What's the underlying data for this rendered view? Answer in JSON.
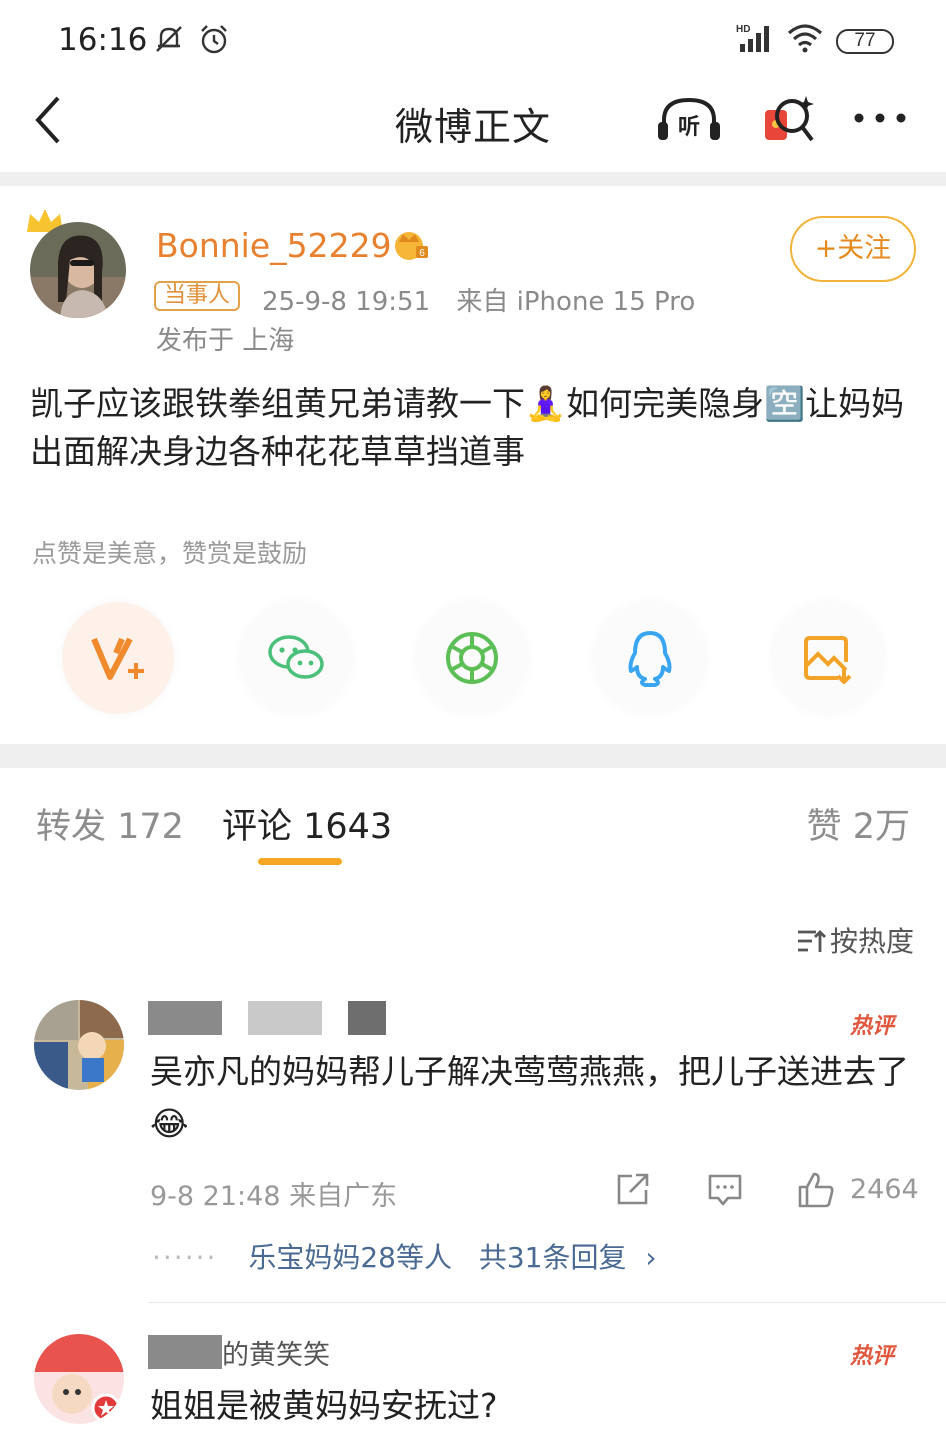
{
  "status": {
    "time": "16:16",
    "battery": "77"
  },
  "nav": {
    "title": "微博正文"
  },
  "post": {
    "username": "Bonnie_52229",
    "role_badge": "当事人",
    "datetime": "25-9-8 19:51",
    "source": "来自 iPhone 15 Pro",
    "location": "发布于 上海",
    "follow_label": "+关注",
    "text": "凯子应该跟铁拳组黄兄弟请教一下🧘‍♀️如何完美隐身🈳让妈妈出面解决身边各种花花草草挡道事",
    "reward_tip": "点赞是美意，赞赏是鼓励"
  },
  "tabs": {
    "repost": "转发 172",
    "comments": "评论 1643",
    "likes": "赞 2万"
  },
  "sort_label": "按热度",
  "comments": [
    {
      "hot_badge": "热评",
      "text": "吴亦凡的妈妈帮儿子解决莺莺燕燕，把儿子送进去了😂",
      "time_location": "9-8 21:48 来自广东",
      "like_count": "2464",
      "replies_users": "乐宝妈妈28等人",
      "replies_total": "共31条回复"
    },
    {
      "hot_badge": "热评",
      "name_partial": "的黄笑笑",
      "text": "姐姐是被黄妈妈安抚过?"
    }
  ],
  "colors": {
    "accent": "#f5a623",
    "username": "#e8812f",
    "link": "#4a6a93",
    "hot": "#e0573e"
  }
}
